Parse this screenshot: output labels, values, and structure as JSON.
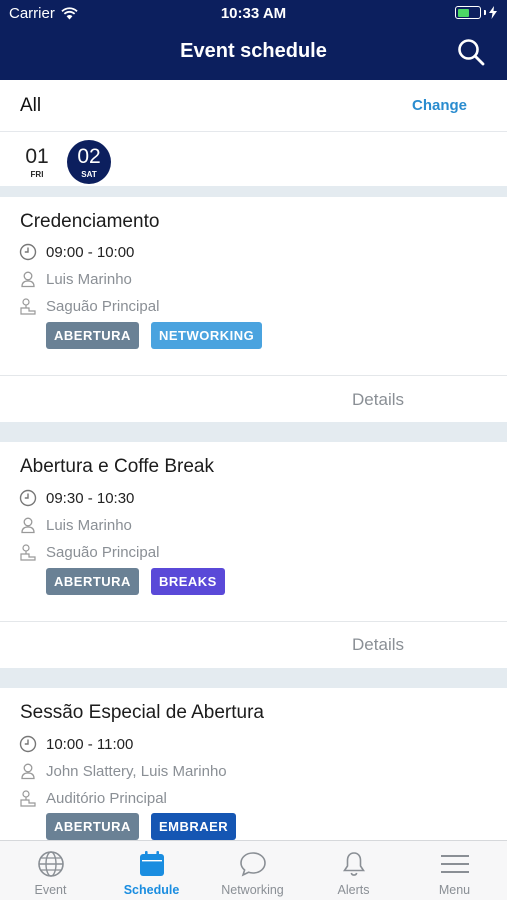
{
  "status_bar": {
    "carrier": "Carrier",
    "time": "10:33 AM"
  },
  "header": {
    "title": "Event schedule",
    "search_icon": "search-icon"
  },
  "filter": {
    "label": "All",
    "change_label": "Change"
  },
  "dates": [
    {
      "day": "01",
      "weekday": "FRI",
      "selected": false
    },
    {
      "day": "02",
      "weekday": "SAT",
      "selected": true
    }
  ],
  "colors": {
    "header_bg": "#0c1f5e",
    "accent": "#1a8de0",
    "tag_abertura": "#6a8195",
    "tag_networking": "#4aa3df",
    "tag_breaks": "#5a49d8",
    "tag_embraer": "#1556b3"
  },
  "sessions": [
    {
      "title": "Credenciamento",
      "time": "09:00 - 10:00",
      "speakers": "Luis Marinho",
      "location": "Saguão Principal",
      "tags": [
        {
          "label": "ABERTURA",
          "color": "#6a8195"
        },
        {
          "label": "NETWORKING",
          "color": "#4aa3df"
        }
      ],
      "details_label": "Details"
    },
    {
      "title": "Abertura e Coffe Break",
      "time": "09:30 - 10:30",
      "speakers": "Luis Marinho",
      "location": "Saguão Principal",
      "tags": [
        {
          "label": "ABERTURA",
          "color": "#6a8195"
        },
        {
          "label": "BREAKS",
          "color": "#5a49d8"
        }
      ],
      "details_label": "Details"
    },
    {
      "title": "Sessão Especial de Abertura",
      "time": "10:00 - 11:00",
      "speakers": "John Slattery, Luis Marinho",
      "location": "Auditório Principal",
      "tags": [
        {
          "label": "ABERTURA",
          "color": "#6a8195"
        },
        {
          "label": "EMBRAER",
          "color": "#1556b3"
        }
      ]
    }
  ],
  "tabbar": [
    {
      "label": "Event",
      "icon": "globe-icon",
      "active": false
    },
    {
      "label": "Schedule",
      "icon": "calendar-icon",
      "active": true
    },
    {
      "label": "Networking",
      "icon": "chat-bubble-icon",
      "active": false
    },
    {
      "label": "Alerts",
      "icon": "bell-icon",
      "active": false
    },
    {
      "label": "Menu",
      "icon": "hamburger-menu-icon",
      "active": false
    }
  ]
}
